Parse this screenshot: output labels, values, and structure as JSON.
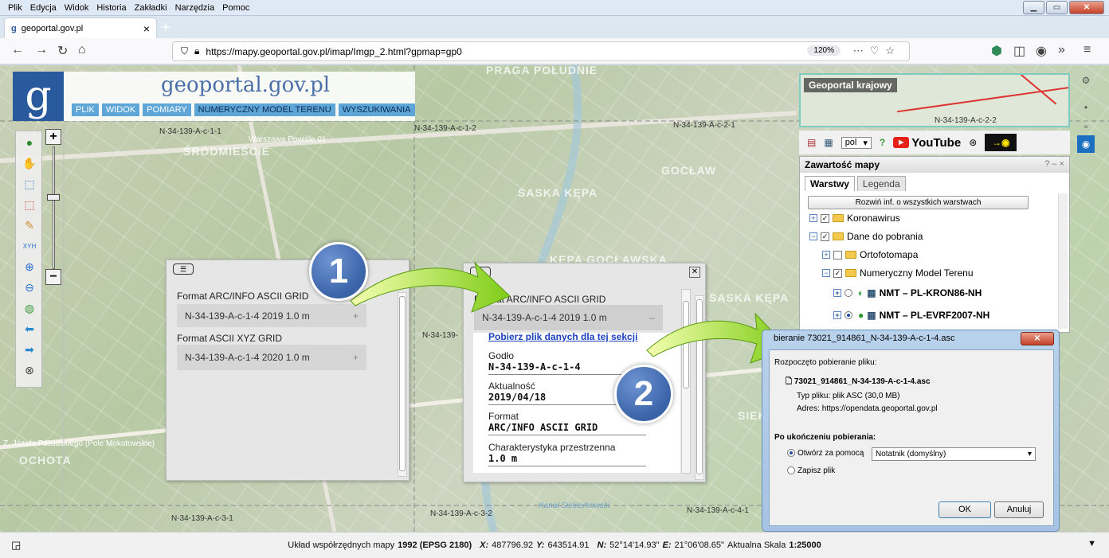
{
  "menubar": {
    "items": [
      "Plik",
      "Edycja",
      "Widok",
      "Historia",
      "Zakładki",
      "Narzędzia",
      "Pomoc"
    ]
  },
  "tab": {
    "title": "geoportal.gov.pl",
    "close": "×"
  },
  "address": {
    "url": "https://mapy.geoportal.gov.pl/imap/Imgp_2.html?gpmap=gp0",
    "zoom": "120%"
  },
  "logo": {
    "letter": "g",
    "title": "geoportal.gov.pl",
    "menu": [
      "PLIK",
      "WIDOK",
      "POMIARY",
      "NUMERYCZNY MODEL TERENU",
      "WYSZUKIWANIA"
    ]
  },
  "map": {
    "sheet_labels": [
      "N-34-139-A-c-1-1",
      "N-34-139-A-c-1-2",
      "N-34-139-A-c-2-1",
      "N-34-139-A-c-3-1",
      "N-34-139-A-c-3-2",
      "N-34-139-A-c-4-1",
      "N-34-139-"
    ],
    "districts": [
      "PRAGA POŁUDNIE",
      "ŚRÓDMIEŚCIE",
      "GOCŁAW",
      "SASKA KĘPA",
      "KĘPA GOCŁAWSKA",
      "SASKA KĘPA",
      "OCHOTA",
      "SIEKIE"
    ],
    "streets": [
      "Warszawa Powiśle 01",
      "Z. Józefa Piłsudskiego (Pole Mokotowskie)",
      "Kanał Siekierkowski"
    ],
    "overview_title": "Geoportal krajowy",
    "overview_sheet": "N-34-139-A-c-2-2"
  },
  "popup1": {
    "formats": [
      {
        "label": "Format ARC/INFO ASCII GRID",
        "item": "N-34-139-A-c-1-4 2019 1.0 m",
        "toggle": "+"
      },
      {
        "label": "Format ASCII XYZ GRID",
        "item": "N-34-139-A-c-1-4 2020 1.0 m",
        "toggle": "+"
      }
    ]
  },
  "popup2": {
    "label": "Format ARC/INFO ASCII GRID",
    "item": "N-34-139-A-c-1-4 2019 1.0 m",
    "toggle": "–",
    "download_link": "Pobierz plik danych dla tej sekcji",
    "fields": [
      {
        "key": "Godło",
        "value": "N-34-139-A-c-1-4"
      },
      {
        "key": "Aktualność",
        "value": "2019/04/18"
      },
      {
        "key": "Format",
        "value": "ARC/INFO ASCII GRID"
      },
      {
        "key": "Charakterystyka przestrzenna",
        "value": "1.0 m"
      }
    ]
  },
  "badges": [
    "1",
    "2"
  ],
  "right_panel": {
    "lang": "pol",
    "youtube": "YouTube",
    "layers_title": "Zawartość mapy",
    "layers_ctrl": "? – ×",
    "tabs": [
      "Warstwy",
      "Legenda"
    ],
    "expand_all": "Rozwiń inf. o wszystkich warstwach",
    "tree": [
      {
        "label": "Koronawirus",
        "checked": true
      },
      {
        "label": "Dane do pobrania",
        "checked": true
      },
      {
        "label": "Ortofotomapa",
        "checked": false
      },
      {
        "label": "Numeryczny Model Terenu",
        "checked": true
      },
      {
        "label": "NMT – PL-KRON86-NH",
        "checked": false
      },
      {
        "label": "NMT – PL-EVRF2007-NH",
        "checked": true
      }
    ]
  },
  "dialog": {
    "title": "bieranie 73021_914861_N-34-139-A-c-1-4.asc",
    "started": "Rozpoczęto pobieranie pliku:",
    "filename": "73021_914861_N-34-139-A-c-1-4.asc",
    "type_label": "Typ pliku:",
    "type_value": "plik ASC (30,0 MB)",
    "addr_label": "Adres:",
    "addr_value": "https://opendata.geoportal.gov.pl",
    "after_label": "Po ukończeniu pobierania:",
    "open_with": "Otwórz za pomocą",
    "app": "Notatnik (domyślny)",
    "save": "Zapisz plik",
    "ok": "OK",
    "cancel": "Anuluj"
  },
  "status": {
    "prefix": "Układ współrzędnych mapy",
    "system": "1992 (EPSG 2180)",
    "x_label": "X:",
    "x": "487796.92",
    "y_label": "Y:",
    "y": "643514.91",
    "n_label": "N:",
    "n": "52°14'14.93\"",
    "e_label": "E:",
    "e": "21°06'08.65\"",
    "scale_label": "Aktualna Skala",
    "scale": "1:25000"
  },
  "colors": {
    "accent": "#2a5a9e",
    "menu": "#5fa6d8",
    "arrow": "#8bd42a",
    "badge": "#3a63a8"
  }
}
